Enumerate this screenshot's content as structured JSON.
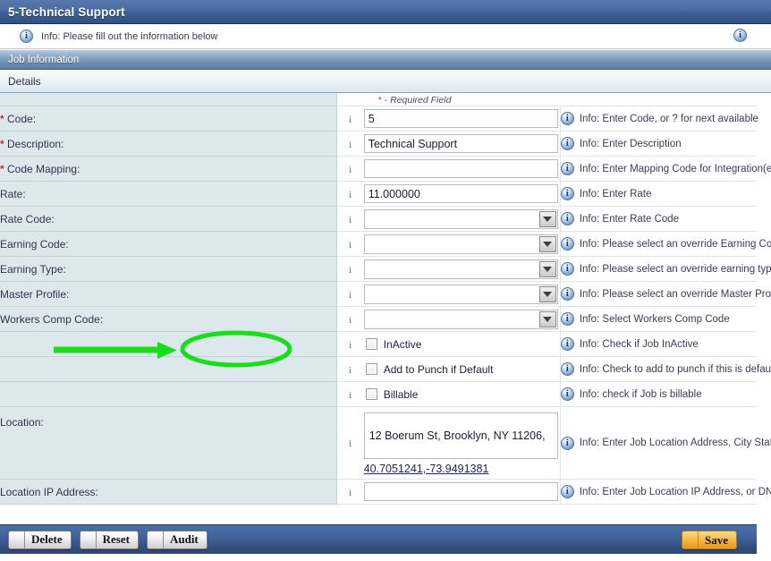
{
  "window": {
    "title": "5-Technical Support"
  },
  "info_bar": {
    "icon": "info-icon",
    "message": "Info: Please fill out the information below",
    "right_icon": "info-icon"
  },
  "section": {
    "title": "Job Information"
  },
  "details": {
    "title": "Details",
    "required_note_star": "*",
    "required_note": "- Required Field"
  },
  "fields": [
    {
      "label": "Code:",
      "required": true,
      "type": "text",
      "value": "5",
      "info": "Info: Enter Code, or ? for next available"
    },
    {
      "label": "Description:",
      "required": true,
      "type": "text",
      "value": "Technical Support",
      "info": "Info: Enter Description"
    },
    {
      "label": "Code Mapping:",
      "required": true,
      "type": "text",
      "value": "",
      "info": "Info: Enter Mapping Code for Integration(e.g GL Export)"
    },
    {
      "label": "Rate:",
      "required": false,
      "type": "text",
      "value": "11.000000",
      "info": "Info: Enter Rate"
    },
    {
      "label": "Rate Code:",
      "required": false,
      "type": "select",
      "value": "",
      "info": "Info: Enter Rate Code"
    },
    {
      "label": "Earning Code:",
      "required": false,
      "type": "select",
      "value": "",
      "info": "Info: Please select an override Earning Code,leave empty for default"
    },
    {
      "label": "Earning Type:",
      "required": false,
      "type": "select",
      "value": "",
      "info": "Info: Please select an override earning type,leave empty for default"
    },
    {
      "label": "Master Profile:",
      "required": false,
      "type": "select",
      "value": "",
      "info": "Info: Please select an override Master Profile,leave empty for default"
    },
    {
      "label": "Workers Comp Code:",
      "required": false,
      "type": "select",
      "value": "",
      "info": "Info: Select Workers Comp Code"
    },
    {
      "label": "",
      "required": false,
      "type": "checkbox",
      "checkbox_label": "InActive",
      "checked": false,
      "highlighted": true,
      "info": "Info: Check if Job InActive"
    },
    {
      "label": "",
      "required": false,
      "type": "checkbox",
      "checkbox_label": "Add to Punch if Default",
      "checked": false,
      "info": "Info: Check to add to punch if this is default employee job"
    },
    {
      "label": "",
      "required": false,
      "type": "checkbox",
      "checkbox_label": "Billable",
      "checked": false,
      "info": "Info: check if Job is billable"
    },
    {
      "label": "Location:",
      "required": false,
      "type": "location",
      "value": "12 Boerum St, Brooklyn, NY 11206,",
      "link": "40.7051241,-73.9491381",
      "info": "Info: Enter Job Location Address, City State Zip"
    },
    {
      "label": "Location IP Address:",
      "required": false,
      "type": "text",
      "value": "",
      "info": "Info: Enter Job Location IP Address, or DNS Name"
    }
  ],
  "footer": {
    "buttons": [
      {
        "label": "Delete",
        "style": "standard"
      },
      {
        "label": "Reset",
        "style": "standard"
      },
      {
        "label": "Audit",
        "style": "standard"
      }
    ],
    "save": {
      "label": "Save",
      "style": "primary"
    }
  },
  "annotation": {
    "color": "#18dd18",
    "arrow": "green-arrow",
    "ellipse": "green-ellipse",
    "target": "InActive"
  }
}
